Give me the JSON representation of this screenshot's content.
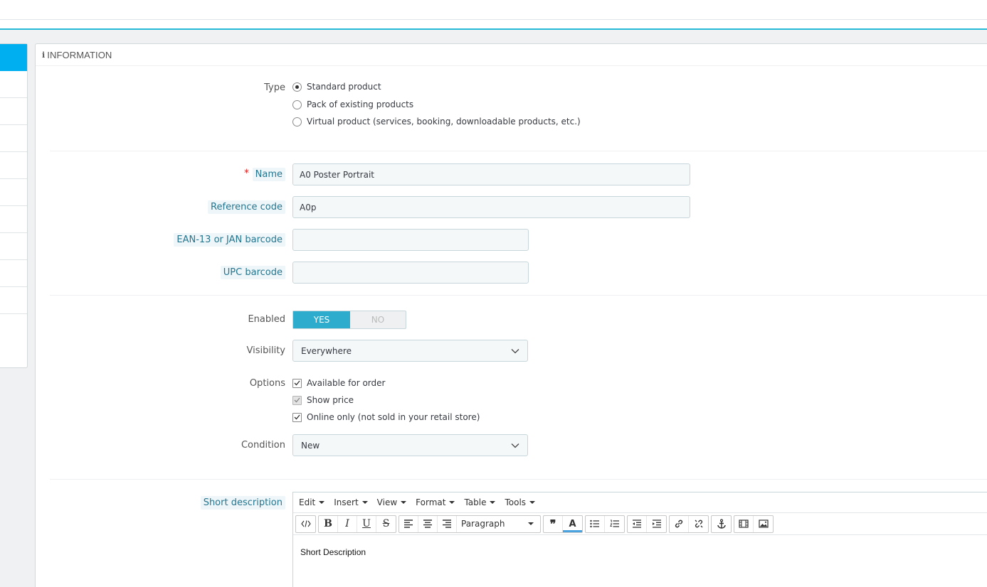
{
  "panel": {
    "heading": "INFORMATION",
    "heading_icon": "info-icon"
  },
  "type": {
    "label": "Type",
    "options": [
      {
        "label": "Standard product",
        "checked": true
      },
      {
        "label": "Pack of existing products",
        "checked": false
      },
      {
        "label": "Virtual product (services, booking, downloadable products, etc.)",
        "checked": false
      }
    ]
  },
  "fields": {
    "name": {
      "label": "Name",
      "required_mark": "*",
      "value": "A0 Poster Portrait"
    },
    "reference": {
      "label": "Reference code",
      "value": "A0p"
    },
    "ean13": {
      "label": "EAN-13 or JAN barcode",
      "value": ""
    },
    "upc": {
      "label": "UPC barcode",
      "value": ""
    }
  },
  "enabled": {
    "label": "Enabled",
    "yes": "YES",
    "no": "NO",
    "value": "YES"
  },
  "visibility": {
    "label": "Visibility",
    "value": "Everywhere"
  },
  "options": {
    "label": "Options",
    "items": [
      {
        "label": "Available for order",
        "checked": true,
        "disabled": false
      },
      {
        "label": "Show price",
        "checked": true,
        "disabled": true
      },
      {
        "label": "Online only (not sold in your retail store)",
        "checked": true,
        "disabled": false
      }
    ]
  },
  "condition": {
    "label": "Condition",
    "value": "New"
  },
  "short_description": {
    "label": "Short description",
    "menus": [
      "Edit",
      "Insert",
      "View",
      "Format",
      "Table",
      "Tools"
    ],
    "format_select": "Paragraph",
    "content": "Short Description"
  },
  "colors": {
    "accent": "#25b9d7",
    "active_tab": "#00aff0",
    "switch_on": "#2eacce",
    "required": "#e21d1d"
  }
}
